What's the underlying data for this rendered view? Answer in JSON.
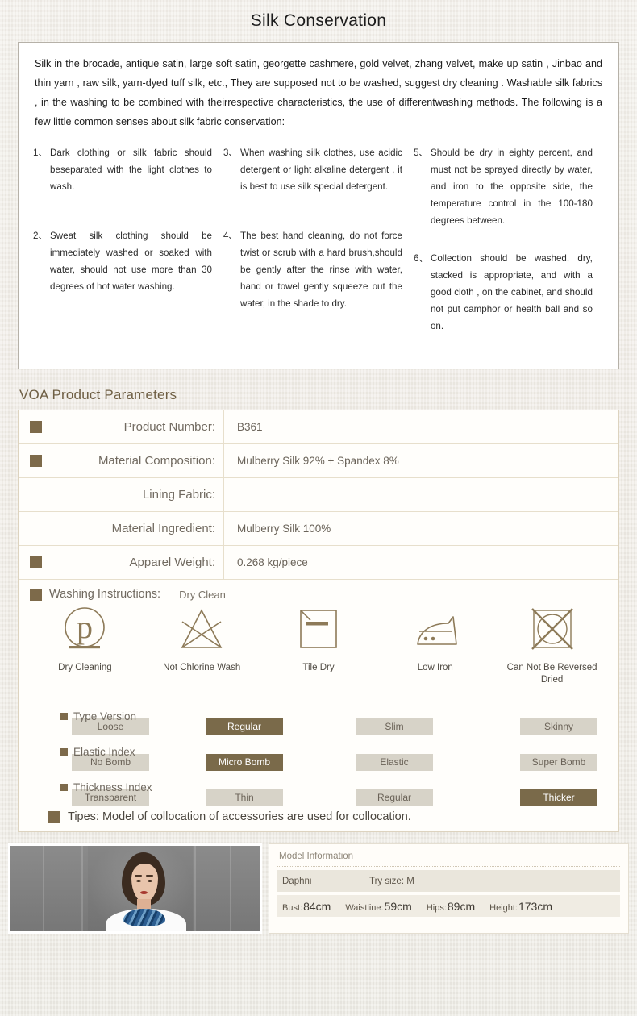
{
  "header": {
    "title": "Silk Conservation"
  },
  "conservation": {
    "intro": "Silk in the brocade, antique satin, large soft satin, georgette cashmere, gold velvet, zhang velvet, make up satin , Jinbao and thin yarn , raw silk, yarn-dyed tuff silk, etc., They are supposed not to be washed, suggest dry cleaning . Washable silk fabrics , in the washing to be combined with theirrespective characteristics, the use of differentwashing methods. The following is a few little common senses about silk fabric conservation:",
    "items": [
      {
        "num": "1、",
        "text": "Dark clothing or silk fabric should beseparated with the light clothes to wash."
      },
      {
        "num": "2、",
        "text": "Sweat silk clothing should be immediately washed or soaked with water, should not use more than 30 degrees of hot water washing."
      },
      {
        "num": "3、",
        "text": "When washing silk clothes, use acidic detergent or light alkaline detergent ,  it  is best to use silk special detergent."
      },
      {
        "num": "4、",
        "text": "The  best hand cleaning, do not force  twist or scrub with a hard brush,should be gently after the rinse with water, hand  or  towel gently squeeze out the water, in the shade to dry."
      },
      {
        "num": "5、",
        "text": "Should  be  dry  in eighty percent, and must not  be sprayed directly by water, and iron to the opposite side, the temperature control in the 100-180 degrees between."
      },
      {
        "num": "6、",
        "text": "Collection should be washed, dry, stacked is appropriate, and with a good  cloth ,  on  the cabinet, and should  not put camphor or health ball and so on."
      }
    ]
  },
  "parameters": {
    "section_title": "VOA Product Parameters",
    "rows": [
      {
        "label": "Product Number:",
        "value": "B361",
        "marker": true
      },
      {
        "label": "Material Composition:",
        "value": "Mulberry Silk 92% + Spandex 8%",
        "marker": true
      },
      {
        "label": "Lining Fabric:",
        "value": "",
        "marker": false
      },
      {
        "label": "Material Ingredient:",
        "value": "Mulberry Silk 100%",
        "marker": false
      },
      {
        "label": "Apparel Weight:",
        "value": "0.268   kg/piece",
        "marker": true
      }
    ]
  },
  "washing": {
    "label": "Washing Instructions:",
    "value": "Dry Clean",
    "icons": [
      {
        "icon": "dry-cleaning-icon",
        "caption": "Dry Cleaning"
      },
      {
        "icon": "not-chlorine-wash-icon",
        "caption": "Not Chlorine Wash"
      },
      {
        "icon": "tile-dry-icon",
        "caption": "Tile Dry"
      },
      {
        "icon": "low-iron-icon",
        "caption": "Low Iron"
      },
      {
        "icon": "no-tumble-dry-icon",
        "caption": "Can Not Be Reversed Dried"
      }
    ]
  },
  "indices": {
    "groups": [
      {
        "label": "Type  Version",
        "options": [
          {
            "text": "Loose",
            "selected": false
          },
          {
            "text": "Regular",
            "selected": true
          },
          {
            "text": "Slim",
            "selected": false
          },
          {
            "text": "Skinny",
            "selected": false
          }
        ]
      },
      {
        "label": "Elastic Index",
        "options": [
          {
            "text": "No  Bomb",
            "selected": false
          },
          {
            "text": "Micro  Bomb",
            "selected": true
          },
          {
            "text": "Elastic",
            "selected": false
          },
          {
            "text": "Super  Bomb",
            "selected": false
          }
        ]
      },
      {
        "label": "Thickness Index",
        "options": [
          {
            "text": "Transparent",
            "selected": false
          },
          {
            "text": "Thin",
            "selected": false
          },
          {
            "text": "Regular",
            "selected": false
          },
          {
            "text": "Thicker",
            "selected": true
          }
        ]
      }
    ]
  },
  "tips": {
    "text": "Tipes:  Model of collocation of accessories are used for collocation."
  },
  "model": {
    "info_title": "Model Information",
    "name": "Daphni",
    "try_size": "Try size: M",
    "metrics": [
      {
        "key": "Bust:",
        "value": "84cm"
      },
      {
        "key": "Waistline:",
        "value": "59cm"
      },
      {
        "key": "Hips:",
        "value": "89cm"
      },
      {
        "key": "Height:",
        "value": "173cm"
      }
    ]
  },
  "colors": {
    "accent_brown": "#7d6a4a",
    "chip_unselected": "#d7d3c8",
    "page_bg": "#efebe4"
  }
}
